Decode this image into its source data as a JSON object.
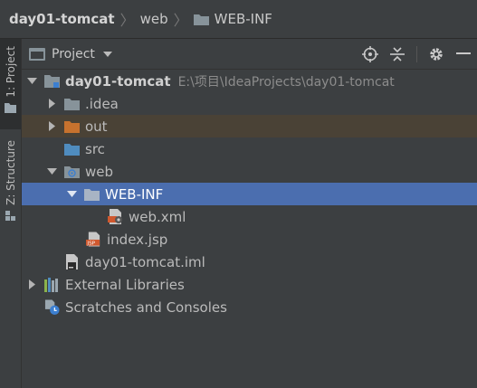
{
  "breadcrumb": {
    "root": "day01-tomcat",
    "web": "web",
    "webinf": "WEB-INF"
  },
  "side_tabs": {
    "project": "1: Project",
    "structure": "Z: Structure"
  },
  "panel": {
    "title": "Project"
  },
  "tree": {
    "project_name": "day01-tomcat",
    "project_path": "E:\\项目\\IdeaProjects\\day01-tomcat",
    "idea": ".idea",
    "out": "out",
    "src": "src",
    "web": "web",
    "webinf": "WEB-INF",
    "webxml": "web.xml",
    "indexjsp": "index.jsp",
    "iml": "day01-tomcat.iml",
    "external": "External Libraries",
    "scratches": "Scratches and Consoles"
  },
  "colors": {
    "selection": "#4b6eaf",
    "excluded_bg": "#4a4236",
    "folder": "#87939a",
    "orange_folder": "#c7722e",
    "source_folder": "#4f8cbf"
  }
}
